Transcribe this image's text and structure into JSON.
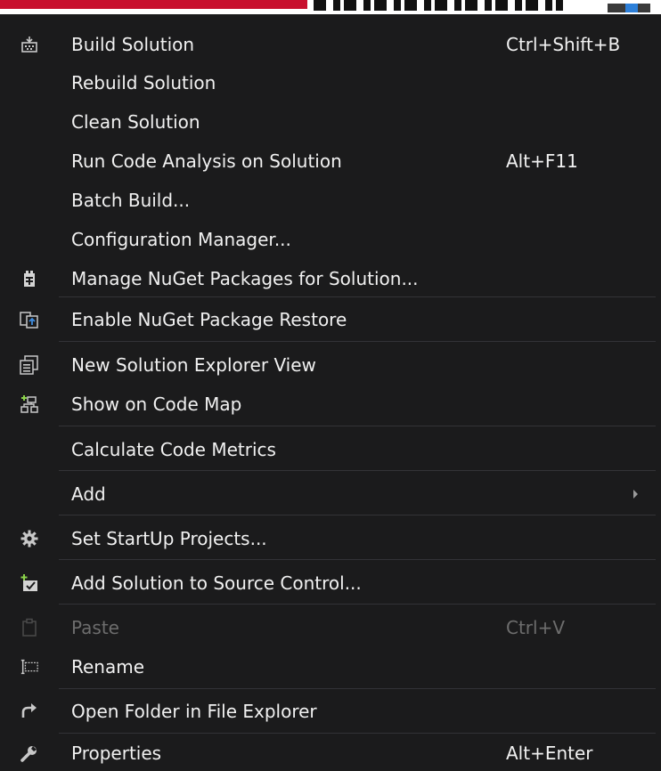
{
  "colors": {
    "background": "#1b1b1c",
    "text": "#f1f1f1",
    "disabled_text": "#6d6d6d",
    "separator": "#333337",
    "icon_gray": "#c8c8c8",
    "icon_green": "#8bd34a",
    "icon_blue": "#3f8de0"
  },
  "menu": {
    "items": [
      {
        "icon": "build-solution-icon",
        "label": "Build Solution",
        "shortcut": "Ctrl+Shift+B"
      },
      {
        "icon": "",
        "label": "Rebuild Solution",
        "shortcut": ""
      },
      {
        "icon": "",
        "label": "Clean Solution",
        "shortcut": ""
      },
      {
        "icon": "",
        "label": "Run Code Analysis on Solution",
        "shortcut": "Alt+F11"
      },
      {
        "icon": "",
        "label": "Batch Build...",
        "shortcut": ""
      },
      {
        "icon": "",
        "label": "Configuration Manager...",
        "shortcut": ""
      },
      {
        "icon": "nuget-package-icon",
        "label": "Manage NuGet Packages for Solution...",
        "shortcut": ""
      },
      {
        "icon": "package-restore-icon",
        "label": "Enable NuGet Package Restore",
        "shortcut": ""
      },
      {
        "icon": "solution-explorer-view-icon",
        "label": "New Solution Explorer View",
        "shortcut": ""
      },
      {
        "icon": "code-map-icon",
        "label": "Show on Code Map",
        "shortcut": ""
      },
      {
        "icon": "",
        "label": "Calculate Code Metrics",
        "shortcut": ""
      },
      {
        "icon": "",
        "label": "Add",
        "shortcut": "",
        "submenu": true
      },
      {
        "icon": "gear-icon",
        "label": "Set StartUp Projects...",
        "shortcut": ""
      },
      {
        "icon": "add-to-source-control-icon",
        "label": "Add Solution to Source Control...",
        "shortcut": ""
      },
      {
        "icon": "paste-icon",
        "label": "Paste",
        "shortcut": "Ctrl+V",
        "disabled": true
      },
      {
        "icon": "rename-icon",
        "label": "Rename",
        "shortcut": ""
      },
      {
        "icon": "open-folder-arrow-icon",
        "label": "Open Folder in File Explorer",
        "shortcut": ""
      },
      {
        "icon": "wrench-icon",
        "label": "Properties",
        "shortcut": "Alt+Enter"
      }
    ]
  }
}
